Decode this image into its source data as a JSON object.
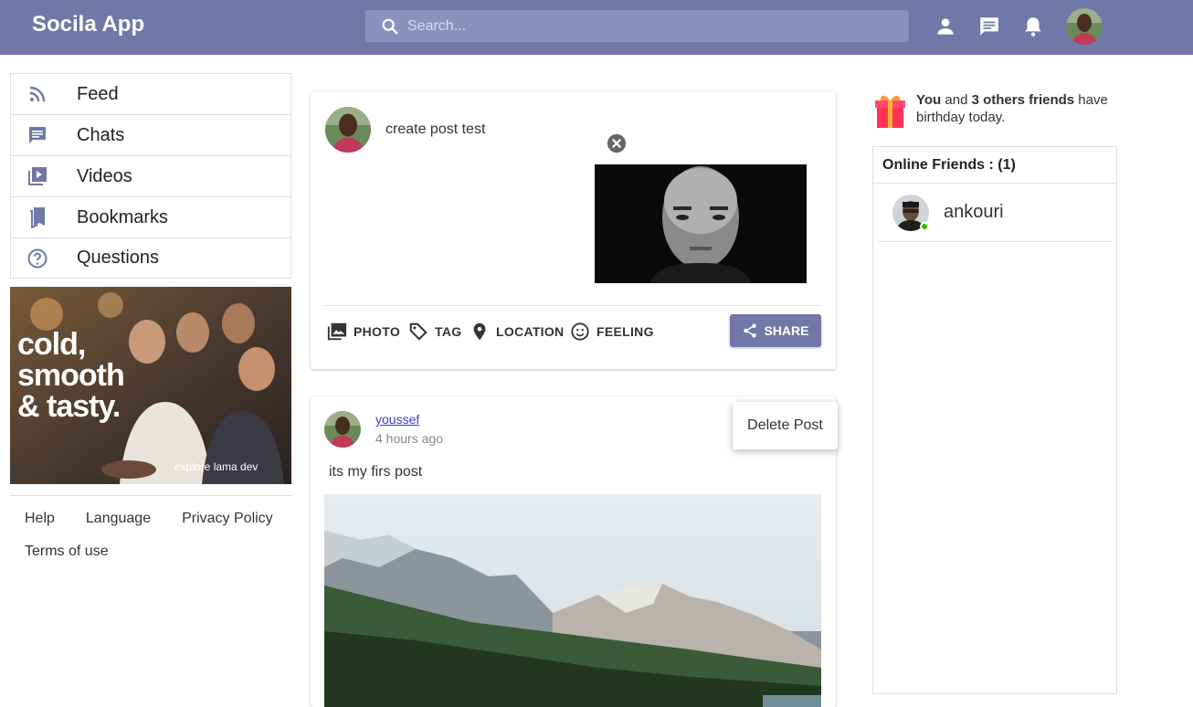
{
  "app": {
    "title": "Socila App"
  },
  "search": {
    "placeholder": "Search..."
  },
  "colors": {
    "primary": "#7078a8",
    "online": "#44b700",
    "link": "#3c3cc0"
  },
  "sidebar": {
    "items": [
      {
        "label": "Feed",
        "icon": "rss-feed-icon"
      },
      {
        "label": "Chats",
        "icon": "chat-icon"
      },
      {
        "label": "Videos",
        "icon": "video-library-icon"
      },
      {
        "label": "Bookmarks",
        "icon": "bookmark-icon"
      },
      {
        "label": "Questions",
        "icon": "help-circle-icon"
      }
    ],
    "ad": {
      "headline": "cold,\nsmooth\n& tasty.",
      "subtext": "explore lama dev"
    },
    "footer": [
      "Help",
      "Language",
      "Privacy Policy",
      "Terms of use"
    ]
  },
  "create_post": {
    "text": "create post test",
    "options": [
      {
        "label": "PHOTO",
        "icon": "photo-library-icon"
      },
      {
        "label": "TAG",
        "icon": "tag-icon"
      },
      {
        "label": "LOCATION",
        "icon": "location-pin-icon"
      },
      {
        "label": "FEELING",
        "icon": "smiley-icon"
      }
    ],
    "share_label": "SHARE"
  },
  "post": {
    "username": "youssef",
    "time": "4 hours ago",
    "text": "its my firs post",
    "menu_item": "Delete Post"
  },
  "right": {
    "birthday": {
      "you": "You",
      "and": " and ",
      "others": "3 others friends",
      "rest": " have birthday today."
    },
    "online_title": "Online Friends : (1)",
    "friends": [
      {
        "name": "ankouri"
      }
    ]
  }
}
